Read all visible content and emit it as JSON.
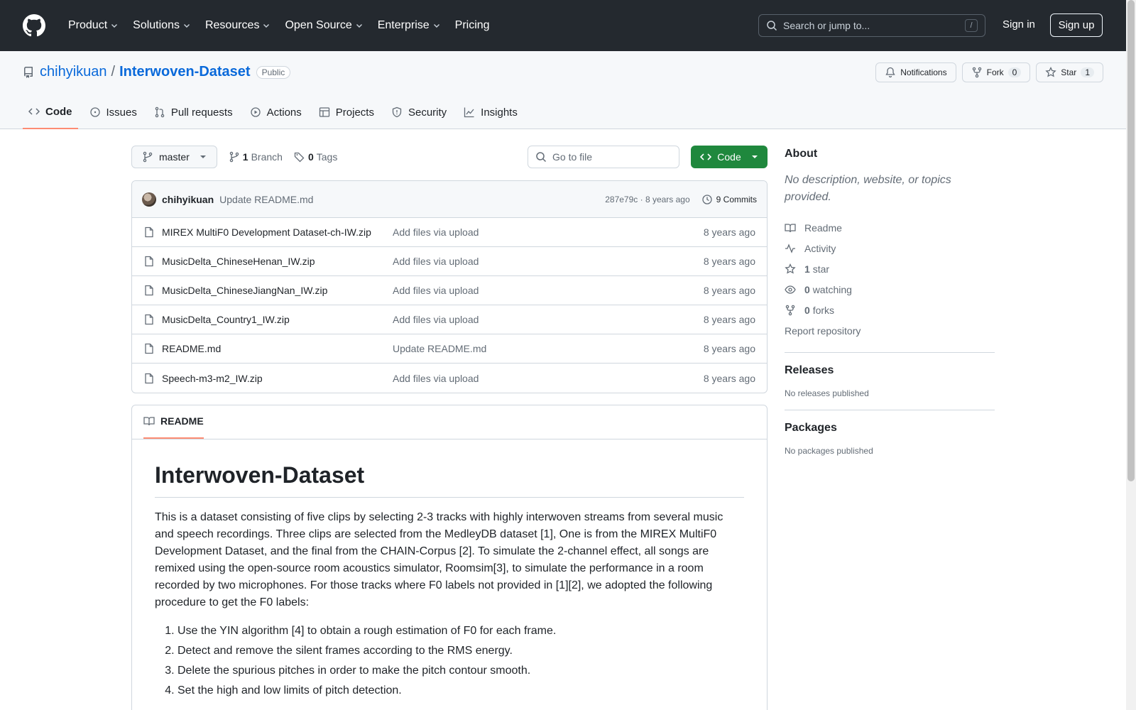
{
  "header": {
    "nav": [
      {
        "label": "Product",
        "has_menu": true
      },
      {
        "label": "Solutions",
        "has_menu": true
      },
      {
        "label": "Resources",
        "has_menu": true
      },
      {
        "label": "Open Source",
        "has_menu": true
      },
      {
        "label": "Enterprise",
        "has_menu": true
      },
      {
        "label": "Pricing",
        "has_menu": false
      }
    ],
    "search_placeholder": "Search or jump to...",
    "search_shortcut": "/",
    "sign_in": "Sign in",
    "sign_up": "Sign up"
  },
  "repo": {
    "owner": "chihyikuan",
    "separator": "/",
    "name": "Interwoven-Dataset",
    "visibility": "Public",
    "notifications_label": "Notifications",
    "fork_label": "Fork",
    "fork_count": "0",
    "star_label": "Star",
    "star_count": "1"
  },
  "tabs": [
    {
      "label": "Code",
      "icon": "code-icon",
      "active": true
    },
    {
      "label": "Issues",
      "icon": "issue-icon",
      "active": false
    },
    {
      "label": "Pull requests",
      "icon": "pull-request-icon",
      "active": false
    },
    {
      "label": "Actions",
      "icon": "play-icon",
      "active": false
    },
    {
      "label": "Projects",
      "icon": "table-icon",
      "active": false
    },
    {
      "label": "Security",
      "icon": "shield-icon",
      "active": false
    },
    {
      "label": "Insights",
      "icon": "graph-icon",
      "active": false
    }
  ],
  "toolbar": {
    "branch": "master",
    "branch_count": "1",
    "branch_label": "Branch",
    "tag_count": "0",
    "tag_label": "Tags",
    "goto_placeholder": "Go to file",
    "code_button": "Code"
  },
  "latest_commit": {
    "author": "chihyikuan",
    "message": "Update README.md",
    "hash_time": "287e79c · 8 years ago",
    "commits": "9 Commits"
  },
  "files": [
    {
      "name": "MIREX MultiF0 Development Dataset-ch-IW.zip",
      "message": "Add files via upload",
      "age": "8 years ago"
    },
    {
      "name": "MusicDelta_ChineseHenan_IW.zip",
      "message": "Add files via upload",
      "age": "8 years ago"
    },
    {
      "name": "MusicDelta_ChineseJiangNan_IW.zip",
      "message": "Add files via upload",
      "age": "8 years ago"
    },
    {
      "name": "MusicDelta_Country1_IW.zip",
      "message": "Add files via upload",
      "age": "8 years ago"
    },
    {
      "name": "README.md",
      "message": "Update README.md",
      "age": "8 years ago"
    },
    {
      "name": "Speech-m3-m2_IW.zip",
      "message": "Add files via upload",
      "age": "8 years ago"
    }
  ],
  "readme": {
    "tab_label": "README",
    "title": "Interwoven-Dataset",
    "paragraph": "This is a dataset consisting of five clips by selecting 2-3 tracks with highly interwoven streams from several music and speech recordings. Three clips are selected from the MedleyDB dataset [1], One is from the MIREX MultiF0 Development Dataset, and the final from the CHAIN-Corpus [2]. To simulate the 2-channel effect, all songs are remixed using the open-source room acoustics simulator, Roomsim[3], to simulate the performance in a room recorded by two microphones. For those tracks where F0 labels not provided in [1][2], we adopted the following procedure to get the F0 labels:",
    "steps": [
      "Use the YIN algorithm [4] to obtain a rough estimation of F0 for each frame.",
      "Detect and remove the silent frames according to the RMS energy.",
      "Delete the spurious pitches in order to make the pitch contour smooth.",
      "Set the high and low limits of pitch detection."
    ]
  },
  "about": {
    "title": "About",
    "description": "No description, website, or topics provided.",
    "readme_label": "Readme",
    "activity_label": "Activity",
    "stars_count": "1",
    "stars_label": "star",
    "watching_count": "0",
    "watching_label": "watching",
    "forks_count": "0",
    "forks_label": "forks",
    "report": "Report repository"
  },
  "releases": {
    "title": "Releases",
    "empty": "No releases published"
  },
  "packages": {
    "title": "Packages",
    "empty": "No packages published"
  },
  "colors": {
    "header_bg": "#24292f",
    "link": "#0969da",
    "green_button": "#1f883d",
    "active_tab_underline": "#fd8c73"
  }
}
